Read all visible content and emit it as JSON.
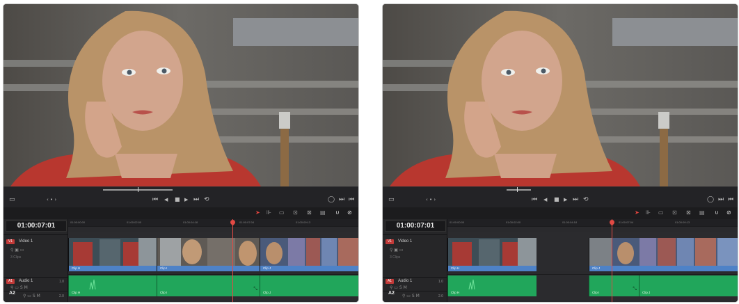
{
  "panels": [
    {
      "timecode": "01:00:07:01",
      "video_track": {
        "tag": "V1",
        "name": "Video 1",
        "clips_count": "3 Clips"
      },
      "audio_track": {
        "tag": "A1",
        "name": "Audio 1",
        "level": "1.0"
      },
      "audio2": {
        "label": "A2",
        "level": "2.0"
      },
      "ruler_ticks": [
        "01:00:00:00",
        "01:00:02:00",
        "01:00:04:18",
        "01:00:07:04",
        "01:00:09:13"
      ],
      "video_clips": [
        {
          "label": "Clip H"
        },
        {
          "label": "Clip I"
        },
        {
          "label": "Clip J"
        }
      ],
      "audio_clips": [
        {
          "label": "Clip H"
        },
        {
          "label": "Clip I"
        },
        {
          "label": "Clip J"
        }
      ]
    },
    {
      "timecode": "01:00:07:01",
      "video_track": {
        "tag": "V1",
        "name": "Video 1",
        "clips_count": "3 Clips"
      },
      "audio_track": {
        "tag": "A1",
        "name": "Audio 1",
        "level": "1.0"
      },
      "audio2": {
        "label": "A2",
        "level": "2.0"
      },
      "ruler_ticks": [
        "01:00:00:00",
        "01:00:02:00",
        "01:00:04:18",
        "01:00:07:04",
        "01:00:09:13"
      ],
      "video_clips": [
        {
          "label": "Clip H"
        },
        {
          "label": "Clip J"
        }
      ],
      "audio_clips": [
        {
          "label": "Clip H"
        },
        {
          "label": "Clip I"
        },
        {
          "label": "Clip J"
        }
      ]
    }
  ],
  "icons": {
    "monitor": "▭",
    "nav_dots": "‹ • ›",
    "first": "⏮",
    "prev": "◀",
    "stop": "■",
    "play": "▶",
    "last": "⏭",
    "loop": "⟲",
    "pointer": "➤",
    "snap": "∪",
    "link": "⊘"
  },
  "colors": {
    "playhead": "#e34a44",
    "video_clip": "#4e82c7",
    "audio_clip": "#21a65b"
  }
}
